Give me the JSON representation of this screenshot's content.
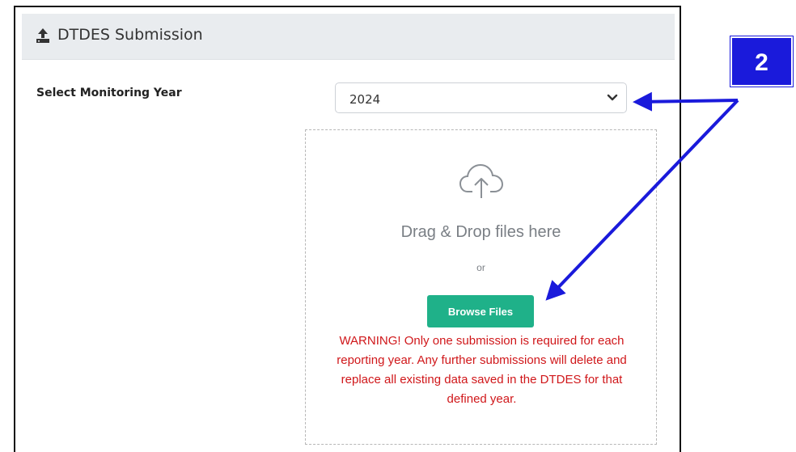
{
  "panel": {
    "title": "DTDES Submission",
    "icon": "upload-icon"
  },
  "form": {
    "year_label": "Select Monitoring Year",
    "year_value": "2024"
  },
  "dropzone": {
    "icon": "cloud-upload-icon",
    "drag_text": "Drag & Drop files here",
    "or_text": "or",
    "browse_label": "Browse Files",
    "warning": "WARNING! Only one submission is required for each reporting year. Any further submissions will delete and replace all existing data saved in the DTDES for that defined year."
  },
  "annotation": {
    "callout_number": "2",
    "color": "#1a1adb"
  },
  "colors": {
    "header_bg": "#e9ecef",
    "button_bg": "#1fb189",
    "warning_text": "#d0171a"
  }
}
